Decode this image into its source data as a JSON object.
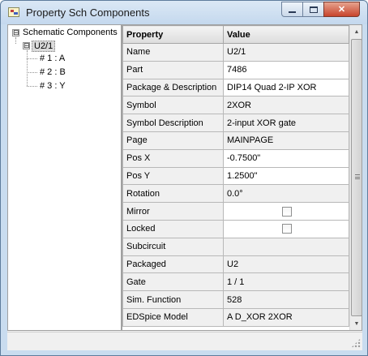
{
  "window": {
    "title": "Property Sch Components",
    "minimize_icon": "minimize-icon",
    "maximize_icon": "maximize-icon",
    "close_glyph": "✕"
  },
  "tree": {
    "root": {
      "label": "Schematic Components",
      "expander": "⊟"
    },
    "component": {
      "label": "U2/1",
      "expander": "⊟"
    },
    "pins": [
      {
        "label": "# 1 : A"
      },
      {
        "label": "# 2 : B"
      },
      {
        "label": "# 3 : Y"
      }
    ]
  },
  "grid": {
    "headers": {
      "property": "Property",
      "value": "Value"
    },
    "rows": [
      {
        "name": "Name",
        "value": "U2/1",
        "editable": false
      },
      {
        "name": "Part",
        "value": "7486",
        "editable": true
      },
      {
        "name": "Package & Description",
        "value": "DIP14 Quad 2-IP XOR",
        "editable": true
      },
      {
        "name": "Symbol",
        "value": "2XOR",
        "editable": false
      },
      {
        "name": "Symbol Description",
        "value": "2-input XOR gate",
        "editable": false
      },
      {
        "name": "Page",
        "value": "MAINPAGE",
        "editable": false
      },
      {
        "name": "Pos X",
        "value": "-0.7500\"",
        "editable": true
      },
      {
        "name": "Pos Y",
        "value": "1.2500\"",
        "editable": true
      },
      {
        "name": "Rotation",
        "value": "0.0°",
        "editable": false
      },
      {
        "name": "Mirror",
        "value": "",
        "checkbox": true,
        "checked": false
      },
      {
        "name": "Locked",
        "value": "",
        "checkbox": true,
        "checked": false
      },
      {
        "name": "Subcircuit",
        "value": "",
        "editable": false
      },
      {
        "name": "Packaged",
        "value": "U2",
        "editable": false
      },
      {
        "name": "Gate",
        "value": "1 / 1",
        "editable": false
      },
      {
        "name": "Sim. Function",
        "value": "528",
        "editable": false
      },
      {
        "name": "EDSpice Model",
        "value": "A D_XOR 2XOR",
        "editable": false
      }
    ]
  },
  "scrollbar": {
    "up_glyph": "▲",
    "down_glyph": "▼"
  }
}
